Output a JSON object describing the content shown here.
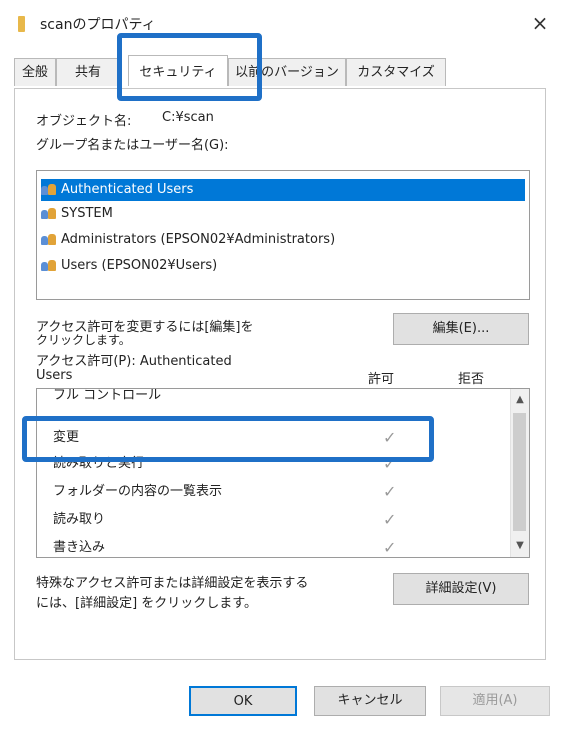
{
  "window": {
    "title": "scanのプロパティ",
    "close_label": "×"
  },
  "tabs": [
    {
      "label": "全般",
      "active": false
    },
    {
      "label": "共有",
      "active": false
    },
    {
      "label": "セキュリティ",
      "active": true
    },
    {
      "label": "以前のバージョン",
      "active": false
    },
    {
      "label": "カスタマイズ",
      "active": false
    }
  ],
  "object": {
    "label": "オブジェクト名:",
    "value": "C:¥scan"
  },
  "group_label": "グループ名またはユーザー名(G):",
  "users": [
    {
      "name": "Authenticated Users",
      "selected": true
    },
    {
      "name": "SYSTEM",
      "selected": false
    },
    {
      "name": "Administrators (EPSON02¥Administrators)",
      "selected": false
    },
    {
      "name": "Users (EPSON02¥Users)",
      "selected": false
    }
  ],
  "change_perm": {
    "text_line1": "アクセス許可を変更するには[編集]を",
    "text_line2": "クリックします。",
    "edit_button": "編集(E)..."
  },
  "permissions": {
    "label_line1": "アクセス許可(P): Authenticated",
    "label_line2": "Users",
    "allow_header": "許可",
    "deny_header": "拒否",
    "rows": [
      {
        "name": "フル コントロール",
        "allow": ""
      },
      {
        "name": "変更",
        "allow": "✓"
      },
      {
        "name": "読み取りと実行",
        "allow": "✓"
      },
      {
        "name": "フォルダーの内容の一覧表示",
        "allow": "✓"
      },
      {
        "name": "読み取り",
        "allow": "✓"
      },
      {
        "name": "書き込み",
        "allow": "✓"
      }
    ]
  },
  "advanced": {
    "text_line1": "特殊なアクセス許可または詳細設定を表示する",
    "text_line2": "には、[詳細設定] をクリックします。",
    "button": "詳細設定(V)"
  },
  "footer": {
    "ok": "OK",
    "cancel": "キャンセル",
    "apply": "適用(A)"
  }
}
